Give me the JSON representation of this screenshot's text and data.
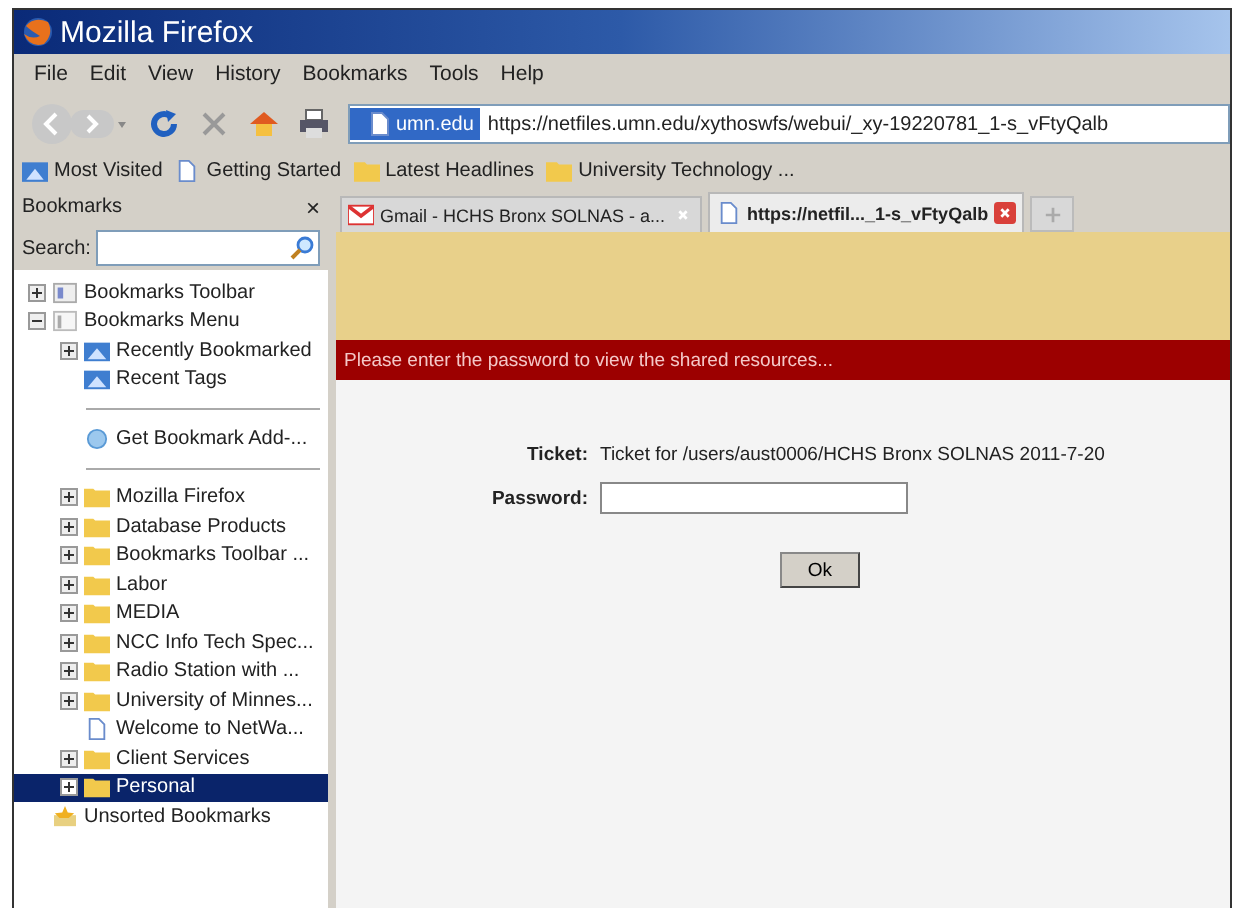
{
  "window": {
    "title": "Mozilla Firefox"
  },
  "menu": [
    "File",
    "Edit",
    "View",
    "History",
    "Bookmarks",
    "Tools",
    "Help"
  ],
  "address": {
    "site": "umn.edu",
    "url": "https://netfiles.umn.edu/xythoswfs/webui/_xy-19220781_1-s_vFtyQalb"
  },
  "bookmarks_bar": [
    {
      "label": "Most Visited",
      "kind": "smart"
    },
    {
      "label": "Getting Started",
      "kind": "page"
    },
    {
      "label": "Latest Headlines",
      "kind": "folder"
    },
    {
      "label": "University Technology ...",
      "kind": "folder"
    }
  ],
  "sidebar": {
    "title": "Bookmarks",
    "close": "×",
    "search_label": "Search:",
    "items": [
      {
        "label": "Bookmarks Toolbar",
        "kind": "toolbar",
        "expanded": false,
        "selected": false
      },
      {
        "label": "Bookmarks Menu",
        "kind": "menu",
        "expanded": true,
        "selected": false,
        "children": [
          {
            "label": "Recently Bookmarked",
            "kind": "smart",
            "expanded": false,
            "selected": false
          },
          {
            "label": "Recent Tags",
            "kind": "smart",
            "selected": false
          },
          {
            "kind": "separator"
          },
          {
            "label": "Get Bookmark Add-...",
            "kind": "addon",
            "selected": false
          },
          {
            "kind": "separator"
          },
          {
            "label": "Mozilla Firefox",
            "kind": "folder",
            "expanded": false,
            "selected": false
          },
          {
            "label": "Database Products",
            "kind": "folder",
            "expanded": false,
            "selected": false
          },
          {
            "label": "Bookmarks Toolbar ...",
            "kind": "folder",
            "expanded": false,
            "selected": false
          },
          {
            "label": "Labor",
            "kind": "folder",
            "expanded": false,
            "selected": false
          },
          {
            "label": "MEDIA",
            "kind": "folder",
            "expanded": false,
            "selected": false
          },
          {
            "label": "NCC Info Tech Spec...",
            "kind": "folder",
            "expanded": false,
            "selected": false
          },
          {
            "label": "Radio Station with ...",
            "kind": "folder",
            "expanded": false,
            "selected": false
          },
          {
            "label": "University of Minnes...",
            "kind": "folder",
            "expanded": false,
            "selected": false
          },
          {
            "label": "Welcome to NetWa...",
            "kind": "page",
            "selected": false
          },
          {
            "label": "Client Services",
            "kind": "folder",
            "expanded": false,
            "selected": false
          },
          {
            "label": "Personal",
            "kind": "folder",
            "expanded": false,
            "selected": true
          }
        ]
      },
      {
        "label": "Unsorted Bookmarks",
        "kind": "unsorted",
        "selected": false
      }
    ]
  },
  "tabs": [
    {
      "label": "Gmail - HCHS Bronx SOLNAS - a...",
      "kind": "mail",
      "selected": false
    },
    {
      "label": "https://netfil..._1-s_vFtyQalb",
      "kind": "page",
      "selected": true
    }
  ],
  "page": {
    "message": "Please enter the password to view the shared resources...",
    "ticket_label": "Ticket:",
    "ticket_value": "Ticket for /users/aust0006/HCHS Bronx SOLNAS 2011-7-20",
    "password_label": "Password:",
    "ok": "Ok"
  }
}
